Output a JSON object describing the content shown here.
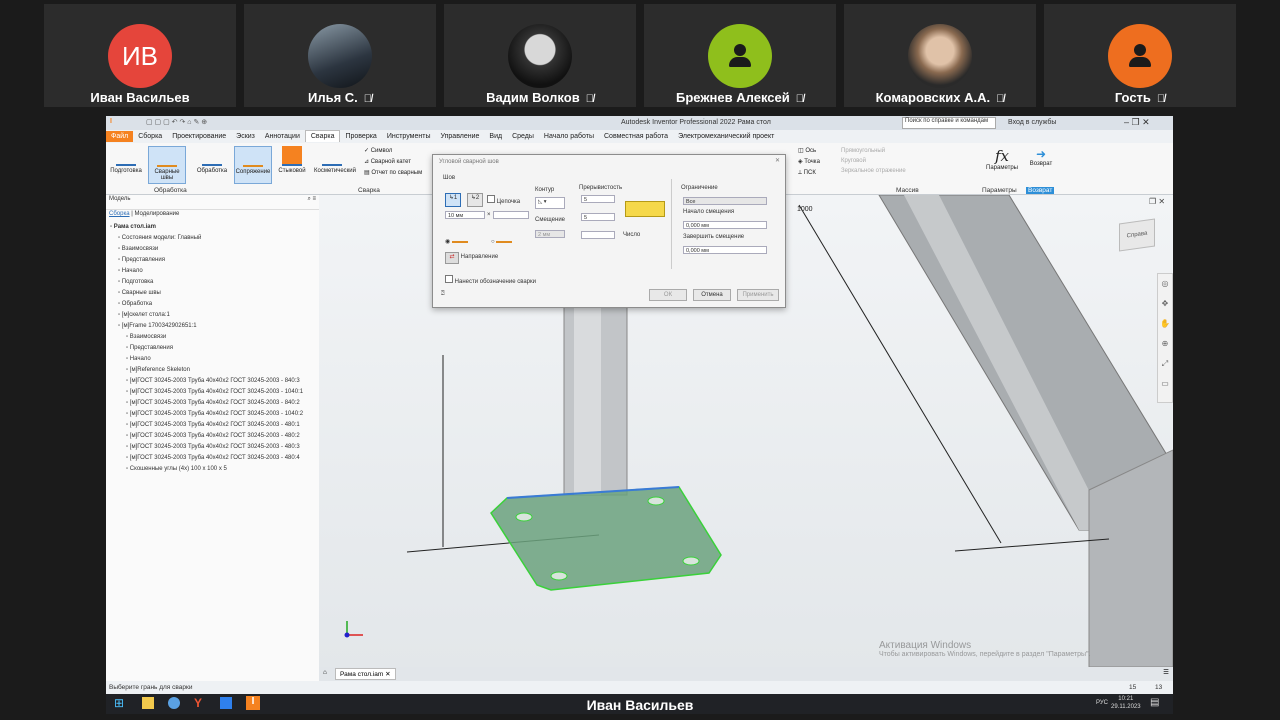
{
  "participants": [
    {
      "name": "Иван Васильев",
      "initials": "ИВ",
      "avatar_color": "#e5453b",
      "muted": false
    },
    {
      "name": "Илья С.",
      "muted": true
    },
    {
      "name": "Вадим Волков",
      "muted": true
    },
    {
      "name": "Брежнев Алексей",
      "avatar_color": "#8fbf1c",
      "muted": true
    },
    {
      "name": "Комаровских А.А.",
      "muted": true
    },
    {
      "name": "Гость",
      "avatar_color": "#ee6e1f",
      "muted": true
    }
  ],
  "app": {
    "title": "Autodesk Inventor Professional 2022   Рама стол",
    "search_placeholder": "Поиск по справке и командам",
    "login": "Вход в службы",
    "menus": [
      "Файл",
      "Сборка",
      "Проектирование",
      "Эскиз",
      "Аннотации",
      "Сварка",
      "Проверка",
      "Инструменты",
      "Управление",
      "Вид",
      "Среды",
      "Начало работы",
      "Совместная работа",
      "Электромеханический проект"
    ],
    "active_menu": "Сварка",
    "ribbon_buttons": [
      "Подготовка",
      "Сварные швы",
      "Обработка",
      "Сопряжение",
      "Стыковой",
      "Косметический"
    ],
    "ribbon_small": [
      "Символ",
      "Сварной катет",
      "Отчет по сварным"
    ],
    "ribbon_groups": [
      "Обработка",
      "Сварка",
      "Массив",
      "Параметры",
      "Возврат"
    ],
    "ribbon_right": [
      "Ось",
      "Точка",
      "ПСК",
      "Прямоугольный",
      "Круговой",
      "Зеркальное отражение",
      "Параметры",
      "Возврат"
    ],
    "accent": "#2d6db5"
  },
  "sidebar": {
    "header": "Модель",
    "tabs": [
      "Сборка",
      "Моделирование"
    ],
    "items": [
      "Рама стол.iam",
      "Состояния модели: Главный",
      "Взаимосвязи",
      "Представления",
      "Начало",
      "Подготовка",
      "Сварные швы",
      "Обработка",
      "[м]скелет стола:1",
      "[м]Frame 1700342902651:1",
      "Взаимосвязи",
      "Представления",
      "Начало",
      "[м]Reference Skeleton",
      "[м]ГОСТ 30245-2003 Труба 40x40x2 ГОСТ 30245-2003 - 840:3",
      "[м]ГОСТ 30245-2003 Труба 40x40x2 ГОСТ 30245-2003 - 1040:1",
      "[м]ГОСТ 30245-2003 Труба 40x40x2 ГОСТ 30245-2003 - 840:2",
      "[м]ГОСТ 30245-2003 Труба 40x40x2 ГОСТ 30245-2003 - 1040:2",
      "[м]ГОСТ 30245-2003 Труба 40x40x2 ГОСТ 30245-2003 - 480:1",
      "[м]ГОСТ 30245-2003 Труба 40x40x2 ГОСТ 30245-2003 - 480:2",
      "[м]ГОСТ 30245-2003 Труба 40x40x2 ГОСТ 30245-2003 - 480:3",
      "[м]ГОСТ 30245-2003 Труба 40x40x2 ГОСТ 30245-2003 - 480:4",
      "Скошенные углы (4x) 100 x 100 x 5"
    ]
  },
  "dialog": {
    "title": "Угловой сварной шов",
    "section": "Шов",
    "chain_label": "Цепочка",
    "size_value": "10 мм",
    "contour_label": "Контур",
    "offset_label": "Смещение",
    "offset_value": "2 мм",
    "direction_label": "Направление",
    "discontinuity_label": "Прерывистость",
    "disc_values": [
      "5",
      "5",
      ""
    ],
    "count_label": "Число",
    "limit_label": "Ограничение",
    "limit_value": "Все",
    "start_offset_label": "Начало смещения",
    "start_offset_value": "0,000 мм",
    "end_offset_label": "Завершить смещение",
    "end_offset_value": "0,000 мм",
    "annotate_label": "Нанести обозначение сварки",
    "ok": "ОК",
    "cancel": "Отмена",
    "apply": "Применить"
  },
  "viewport": {
    "dim_label": "1000",
    "viewcube": "Справа",
    "watermark_title": "Активация Windows",
    "watermark_text": "Чтобы активировать Windows, перейдите в раздел \"Параметры\"."
  },
  "document_tab": "Рама стол.iam",
  "status_text": "Выберите грань для сварки",
  "status_numbers": [
    "15",
    "13"
  ],
  "taskbar": {
    "lang": "РУС",
    "time": "10:21",
    "date": "29.11.2023"
  },
  "speaker": "Иван Васильев"
}
